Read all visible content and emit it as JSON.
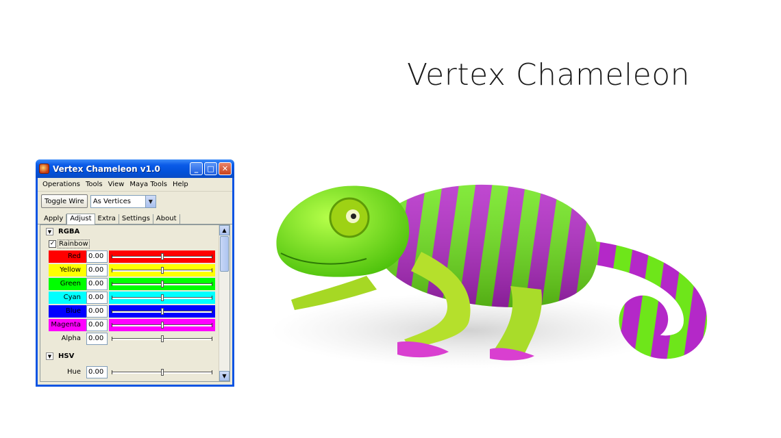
{
  "slide": {
    "title": "Vertex Chameleon"
  },
  "window": {
    "title": "Vertex Chameleon v1.0",
    "controls": {
      "minimize": "_",
      "maximize": "□",
      "close": "✕"
    },
    "menu": [
      "Operations",
      "Tools",
      "View",
      "Maya Tools",
      "Help"
    ],
    "toolbar": {
      "toggle_label": "Toggle Wire",
      "mode_value": "As Vertices"
    },
    "tabs": [
      {
        "label": "Apply",
        "active": false
      },
      {
        "label": "Adjust",
        "active": true
      },
      {
        "label": "Extra",
        "active": false
      },
      {
        "label": "Settings",
        "active": false
      },
      {
        "label": "About",
        "active": false
      }
    ],
    "rgba": {
      "header": "RGBA",
      "rainbow_label": "Rainbow",
      "rainbow_checked": true,
      "channels": [
        {
          "label": "Red",
          "value": "0.00",
          "color": "#ff0000",
          "level": 0.5
        },
        {
          "label": "Yellow",
          "value": "0.00",
          "color": "#ffff00",
          "level": 0.5
        },
        {
          "label": "Green",
          "value": "0.00",
          "color": "#00ff00",
          "level": 0.5
        },
        {
          "label": "Cyan",
          "value": "0.00",
          "color": "#00ffff",
          "level": 0.5
        },
        {
          "label": "Blue",
          "value": "0.00",
          "color": "#0000ff",
          "level": 0.5
        },
        {
          "label": "Magenta",
          "value": "0.00",
          "color": "#ff00ff",
          "level": 0.5
        },
        {
          "label": "Alpha",
          "value": "0.00",
          "color": "",
          "level": 0.5
        }
      ]
    },
    "hsv": {
      "header": "HSV",
      "channels": [
        {
          "label": "Hue",
          "value": "0.00",
          "color": "",
          "level": 0.5
        }
      ]
    }
  },
  "colors": {
    "chameleon_green": "#6ee61a",
    "chameleon_purple": "#b428c8",
    "xp_blue": "#0a54e3"
  }
}
